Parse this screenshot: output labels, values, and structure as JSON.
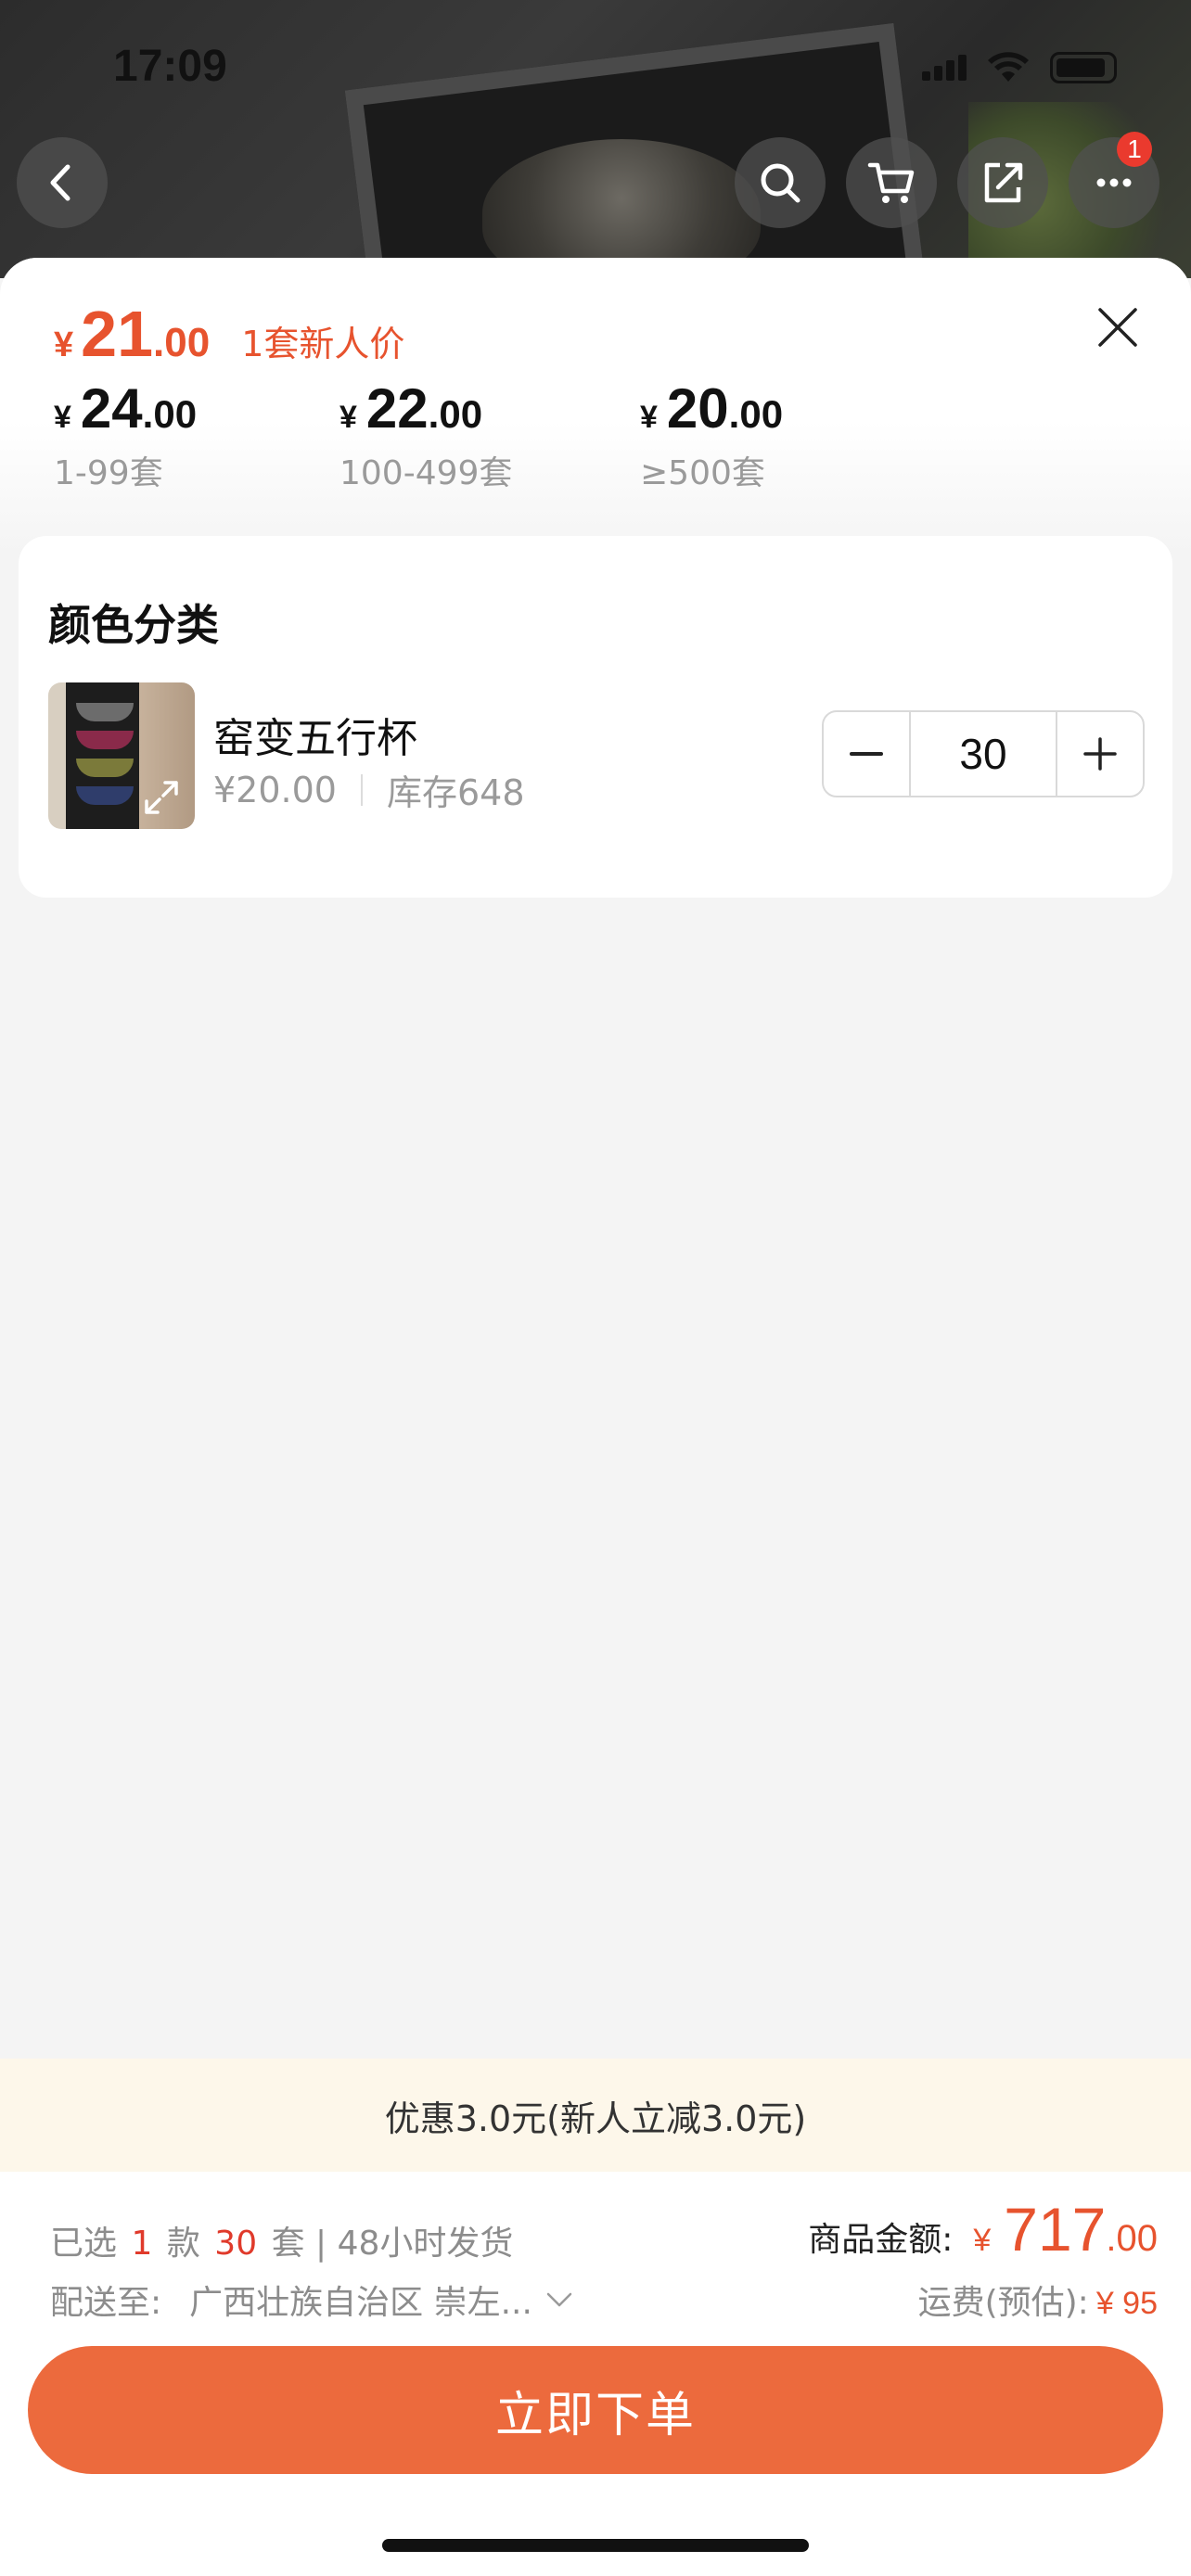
{
  "status_bar": {
    "time": "17:09"
  },
  "product_nav": {
    "cart_badge": "1"
  },
  "sheet": {
    "main_price": {
      "currency": "¥",
      "integer": "21",
      "decimal": ".00",
      "tag": "1套新人价"
    },
    "tiers": [
      {
        "currency": "¥",
        "integer": "24",
        "decimal": ".00",
        "range": "1-99套"
      },
      {
        "currency": "¥",
        "integer": "22",
        "decimal": ".00",
        "range": "100-499套"
      },
      {
        "currency": "¥",
        "integer": "20",
        "decimal": ".00",
        "range": "≥500套"
      }
    ],
    "variant_section": {
      "title": "颜色分类",
      "item": {
        "name": "窑变五行杯",
        "price": "¥20.00",
        "stock": "库存648",
        "quantity": "30"
      }
    }
  },
  "promo": {
    "text": "优惠3.0元(新人立减3.0元)"
  },
  "order": {
    "selected_prefix": "已选",
    "selected_count": "1",
    "selected_count_unit": "款",
    "selected_qty": "30",
    "selected_qty_unit": "套 | 48小时发货",
    "ship_label": "配送至:",
    "ship_address": "广西壮族自治区 崇左...",
    "total_label": "商品金额:",
    "total_currency": "¥",
    "total_integer": "717",
    "total_decimal": ".00",
    "freight_label": "运费(预估):",
    "freight_value": "¥ 95",
    "submit_label": "立即下单"
  },
  "colors": {
    "accent": "#ec6a3d",
    "price": "#e7532e",
    "promo_bg": "#fdf7ea"
  }
}
